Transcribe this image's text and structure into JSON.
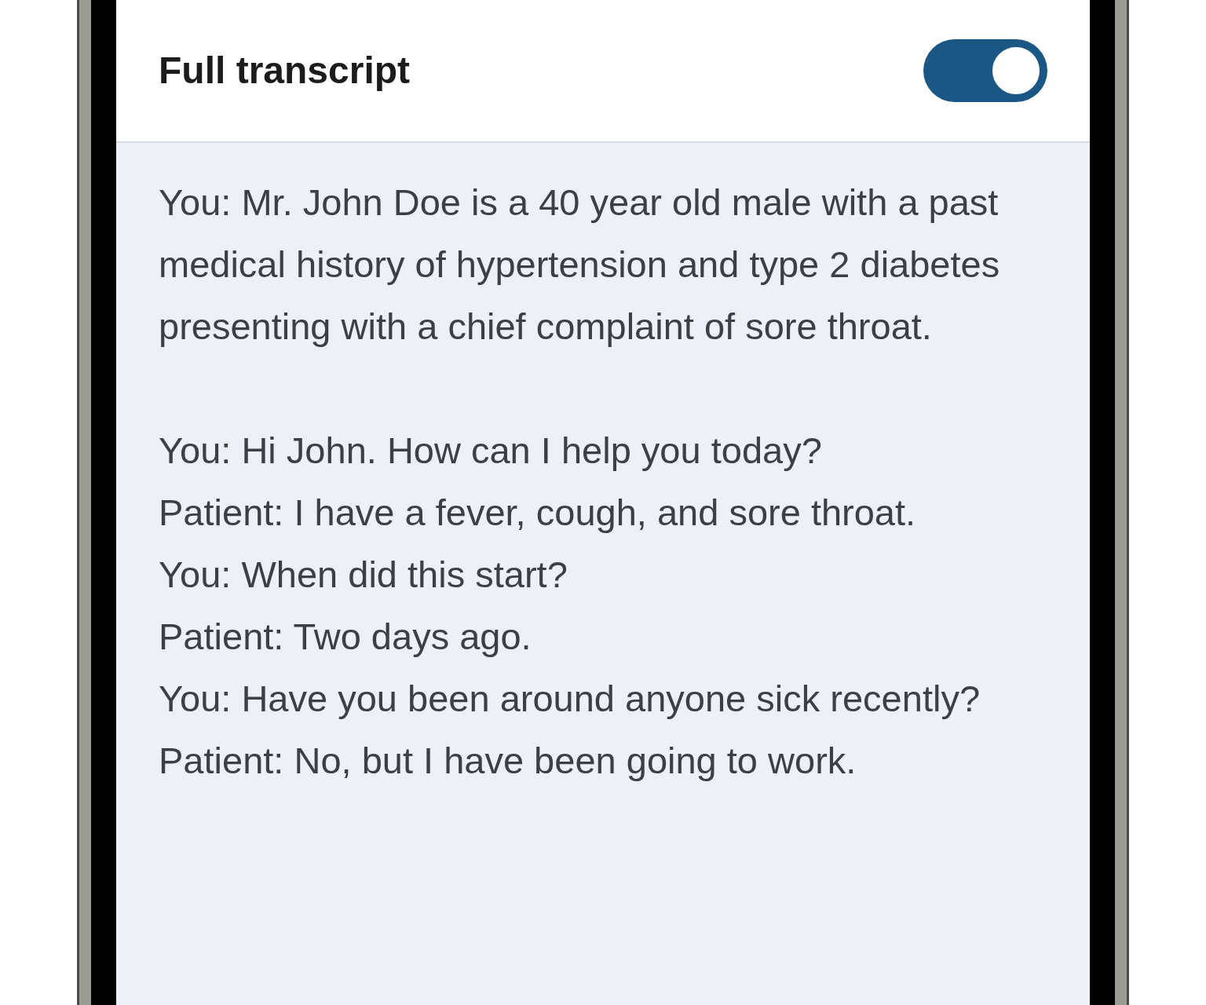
{
  "header": {
    "title": "Full transcript",
    "toggle": {
      "on": true
    }
  },
  "transcript": [
    [
      "You: Mr. John Doe is a 40 year old male with a past medical history of hypertension and type 2 diabetes presenting with a chief complaint of sore throat."
    ],
    [
      "You: Hi John. How can I help you today?",
      "Patient: I have a fever, cough, and sore throat.",
      "You: When did this start?",
      "Patient: Two days ago.",
      "You: Have you been around anyone sick recently?",
      "Patient: No, but I have been going to work."
    ]
  ]
}
